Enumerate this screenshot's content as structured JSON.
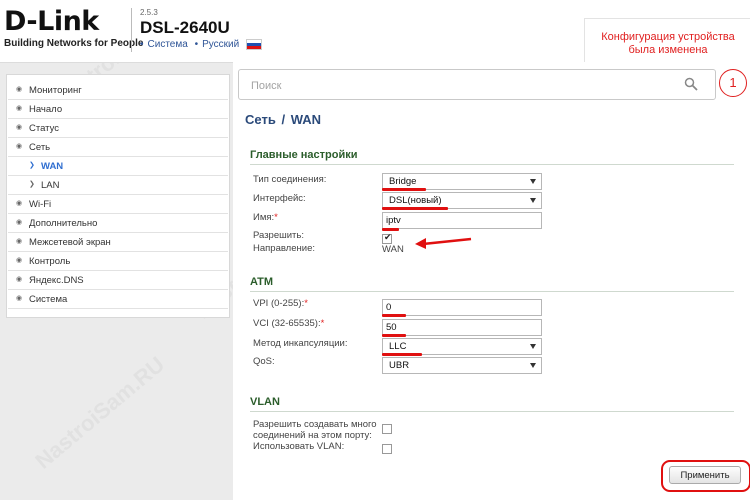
{
  "header": {
    "logo": "D-Link",
    "tagline": "Building Networks for People",
    "version": "2.5.3",
    "model": "DSL-2640U",
    "system_link": "Система",
    "language_link": "Русский",
    "notice_line1": "Конфигурация устройства",
    "notice_line2": "была изменена"
  },
  "search": {
    "placeholder": "Поиск",
    "badge": "1"
  },
  "sidebar": {
    "items": [
      {
        "label": "Мониторинг"
      },
      {
        "label": "Начало"
      },
      {
        "label": "Статус"
      },
      {
        "label": "Сеть"
      },
      {
        "label": "WAN"
      },
      {
        "label": "LAN"
      },
      {
        "label": "Wi-Fi"
      },
      {
        "label": "Дополнительно"
      },
      {
        "label": "Межсетевой экран"
      },
      {
        "label": "Контроль"
      },
      {
        "label": "Яндекс.DNS"
      },
      {
        "label": "Система"
      }
    ]
  },
  "page": {
    "crumb1": "Сеть",
    "sep": "/",
    "crumb2": "WAN"
  },
  "main_settings": {
    "title": "Главные настройки",
    "conn_type_label": "Тип соединения:",
    "conn_type_value": "Bridge",
    "interface_label": "Интерфейс:",
    "interface_value": "DSL(новый)",
    "name_label": "Имя:",
    "name_value": "iptv",
    "enable_label": "Разрешить:",
    "enable_checked": true,
    "direction_label": "Направление:",
    "direction_value": "WAN"
  },
  "atm": {
    "title": "ATM",
    "vpi_label": "VPI (0-255):",
    "vpi_value": "0",
    "vci_label": "VCI (32-65535):",
    "vci_value": "50",
    "encap_label": "Метод инкапсуляции:",
    "encap_value": "LLC",
    "qos_label": "QoS:",
    "qos_value": "UBR"
  },
  "vlan": {
    "title": "VLAN",
    "multi_label_1": "Разрешить создавать много",
    "multi_label_2": "соединений на этом порту:",
    "use_vlan_label": "Использовать VLAN:"
  },
  "apply_label": "Применить",
  "watermark": "NastroiSam.RU",
  "colors": {
    "accent_red": "#e01010",
    "link_blue": "#2f6ed0",
    "section_green": "#2b5d2b"
  }
}
